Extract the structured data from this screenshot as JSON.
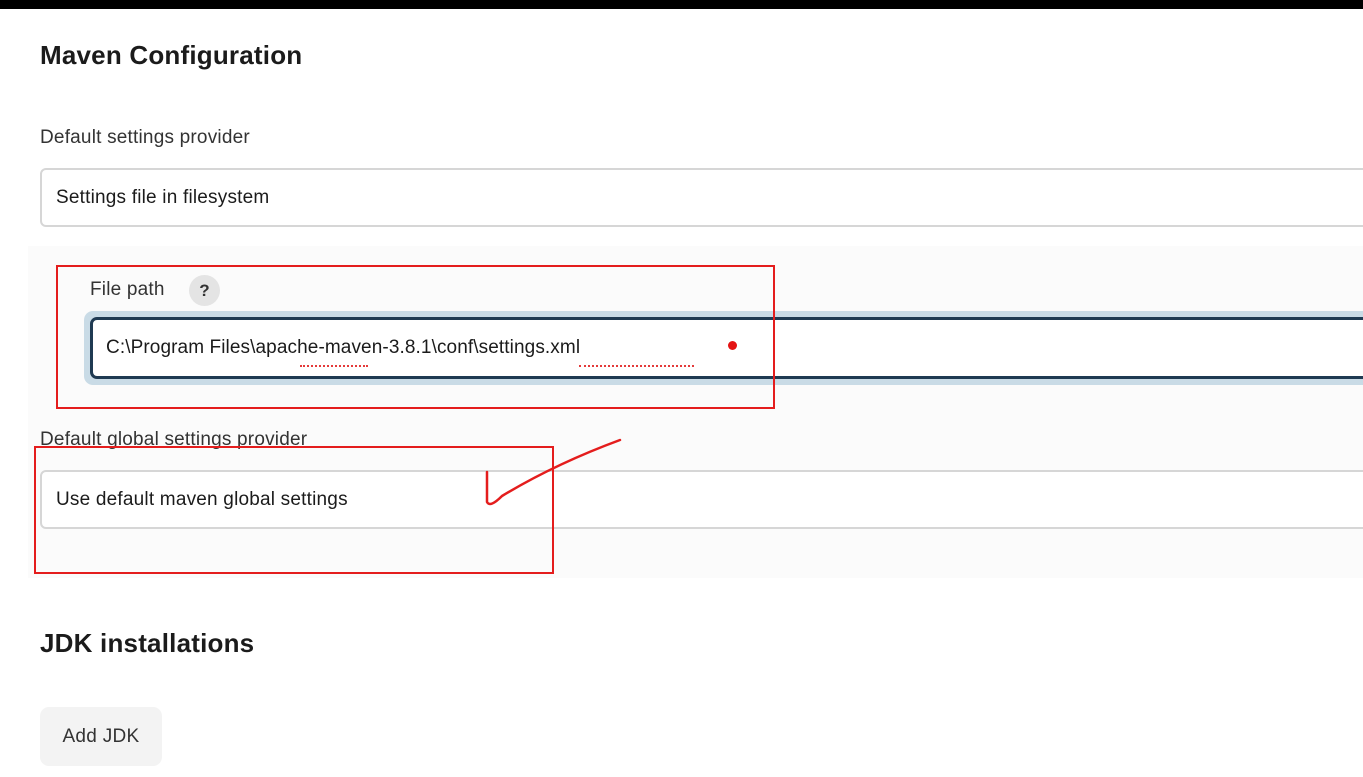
{
  "maven_configuration": {
    "title": "Maven Configuration",
    "default_settings_provider": {
      "label": "Default settings provider",
      "selected": "Settings file in filesystem"
    },
    "file_path": {
      "label": "File path",
      "help": "?",
      "value": "C:\\Program Files\\apache-maven-3.8.1\\conf\\settings.xml"
    },
    "default_global_settings_provider": {
      "label": "Default global settings provider",
      "selected": "Use default maven global settings"
    }
  },
  "jdk_installations": {
    "title": "JDK installations",
    "add_button_label": "Add JDK"
  },
  "colors": {
    "annotation_red": "#e41d1d",
    "input_border": "#1f3a52",
    "focus_ring": "#c9dbe6"
  }
}
